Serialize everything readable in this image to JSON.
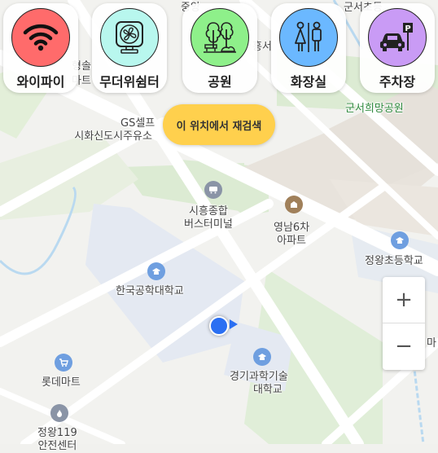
{
  "categories": [
    {
      "label": "와이파이",
      "icon": "wifi-icon",
      "color": "#ff6b6b"
    },
    {
      "label": "무더위쉼터",
      "icon": "fan-icon",
      "color": "#b8f7ee"
    },
    {
      "label": "공원",
      "icon": "park-icon",
      "color": "#8ef08a"
    },
    {
      "label": "화장실",
      "icon": "restroom-icon",
      "color": "#6bb8ff"
    },
    {
      "label": "주차장",
      "icon": "parking-icon",
      "color": "#c99bf5"
    }
  ],
  "search_here": "이 위치에서 재검색",
  "zoom": {
    "in": "+",
    "out": "−"
  },
  "map_labels": {
    "top_center": "중앙",
    "top_right": "군서초등",
    "heungseo": "흥서",
    "left_top": "형솔",
    "left_top2": "마트",
    "park": "군서희망공원",
    "gs1": "GS셀프",
    "gs2": "시화신도시주유소",
    "bus1": "시흥종합",
    "bus2": "버스터미널",
    "apt1": "영남6차",
    "apt2": "아파트",
    "school": "정왕초등학교",
    "univ": "한국공학대학교",
    "gsci1": "경기과학기술",
    "gsci2": "대학교",
    "lotte": "롯데마트",
    "fire1": "정왕119",
    "fire2": "안전센터",
    "right_edge": "마"
  },
  "colors": {
    "accent": "#ffd04d",
    "location": "#2a6ff2"
  }
}
